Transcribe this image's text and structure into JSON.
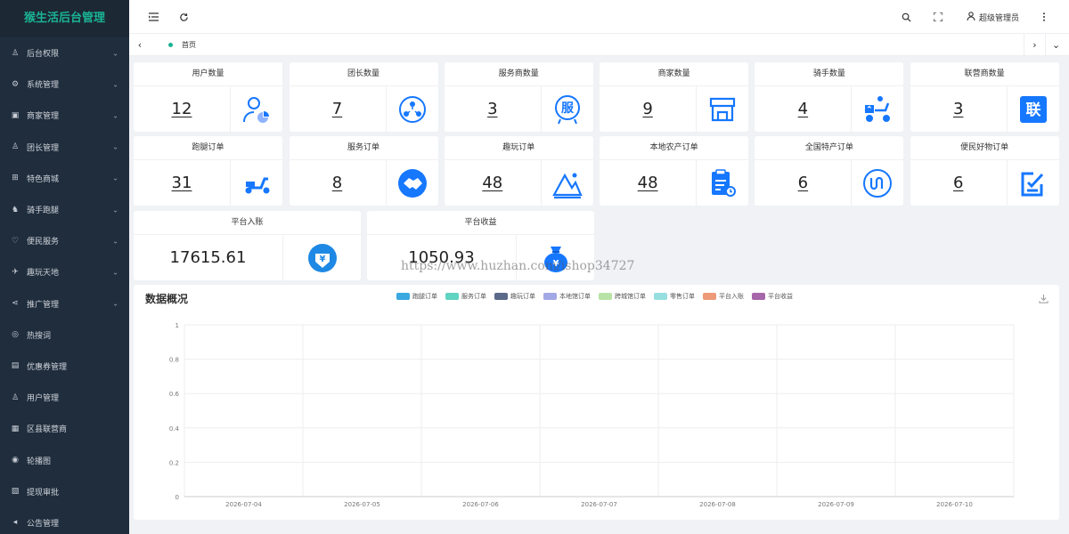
{
  "app": {
    "title": "猴生活后台管理"
  },
  "sidebar": {
    "items": [
      {
        "label": "后台权限",
        "icon": "user-icon",
        "glyph": "♙",
        "arrow": true
      },
      {
        "label": "系统管理",
        "icon": "gear-icon",
        "glyph": "⚙",
        "arrow": true
      },
      {
        "label": "商家管理",
        "icon": "store-icon",
        "glyph": "▣",
        "arrow": true
      },
      {
        "label": "团长管理",
        "icon": "person-icon",
        "glyph": "♙",
        "arrow": true
      },
      {
        "label": "特色商城",
        "icon": "cart-icon",
        "glyph": "⊞",
        "arrow": true
      },
      {
        "label": "骑手跑腿",
        "icon": "rider-icon",
        "glyph": "♞",
        "arrow": true
      },
      {
        "label": "便民服务",
        "icon": "heart-icon",
        "glyph": "♡",
        "arrow": true
      },
      {
        "label": "趣玩天地",
        "icon": "pin-icon",
        "glyph": "✈",
        "arrow": true
      },
      {
        "label": "推广管理",
        "icon": "share-icon",
        "glyph": "⋖",
        "arrow": true
      },
      {
        "label": "热搜词",
        "icon": "fire-icon",
        "glyph": "◎",
        "arrow": false
      },
      {
        "label": "优惠券管理",
        "icon": "coupon-icon",
        "glyph": "▤",
        "arrow": false
      },
      {
        "label": "用户管理",
        "icon": "users-icon",
        "glyph": "♙",
        "arrow": false
      },
      {
        "label": "区县联营商",
        "icon": "region-icon",
        "glyph": "▦",
        "arrow": false
      },
      {
        "label": "轮播图",
        "icon": "carousel-icon",
        "glyph": "◉",
        "arrow": false
      },
      {
        "label": "提现审批",
        "icon": "withdraw-icon",
        "glyph": "▧",
        "arrow": false
      },
      {
        "label": "公告管理",
        "icon": "notice-icon",
        "glyph": "◂",
        "arrow": false
      }
    ]
  },
  "header": {
    "user": "超级管理员"
  },
  "tabs": {
    "home": "首页"
  },
  "colors": {
    "accent": "#1ab394",
    "icon_blue": "#1677ff",
    "sidebar_bg": "#1f2d3d"
  },
  "cards": [
    {
      "title": "用户数量",
      "value": "12",
      "icon": "user-chart-icon"
    },
    {
      "title": "团长数量",
      "value": "7",
      "icon": "team-network-icon"
    },
    {
      "title": "服务商数量",
      "value": "3",
      "icon": "service-badge-icon",
      "glyph": "服"
    },
    {
      "title": "商家数量",
      "value": "9",
      "icon": "shop-icon"
    },
    {
      "title": "骑手数量",
      "value": "4",
      "icon": "scooter-rider-icon"
    },
    {
      "title": "联营商数量",
      "value": "3",
      "icon": "union-badge-icon",
      "glyph": "联"
    },
    {
      "title": "跑腿订单",
      "value": "31",
      "icon": "scooter-icon"
    },
    {
      "title": "服务订单",
      "value": "8",
      "icon": "handshake-icon"
    },
    {
      "title": "趣玩订单",
      "value": "48",
      "icon": "mountain-icon"
    },
    {
      "title": "本地农产订单",
      "value": "48",
      "icon": "clipboard-icon"
    },
    {
      "title": "全国特产订单",
      "value": "6",
      "icon": "route-icon"
    },
    {
      "title": "便民好物订单",
      "value": "6",
      "icon": "edit-check-icon"
    },
    {
      "title": "平台入账",
      "value": "17615.61",
      "icon": "yuan-down-icon",
      "glyph": "¥"
    },
    {
      "title": "平台收益",
      "value": "1050.93",
      "icon": "money-bag-icon",
      "glyph": "¥"
    }
  ],
  "watermark": "https://www.huzhan.com/ishop34727",
  "chart_data": {
    "type": "line",
    "title": "数据概况",
    "x": [
      "2026-07-04",
      "2026-07-05",
      "2026-07-06",
      "2026-07-07",
      "2026-07-08",
      "2026-07-09",
      "2026-07-10"
    ],
    "yticks": [
      "0",
      "0.2",
      "0.4",
      "0.6",
      "0.8",
      "1"
    ],
    "ylim": [
      0,
      1
    ],
    "grid": true,
    "legend_position": "top",
    "series": [
      {
        "name": "跑腿订单",
        "color": "#3ba8e0",
        "values": []
      },
      {
        "name": "服务订单",
        "color": "#5fd4c0",
        "values": []
      },
      {
        "name": "趣玩订单",
        "color": "#5b6a8a",
        "values": []
      },
      {
        "name": "本地馆订单",
        "color": "#a3a8e6",
        "values": []
      },
      {
        "name": "跨城馆订单",
        "color": "#b8e3a6",
        "values": []
      },
      {
        "name": "零售订单",
        "color": "#97dedf",
        "values": []
      },
      {
        "name": "平台入账",
        "color": "#ee9a78",
        "values": []
      },
      {
        "name": "平台收益",
        "color": "#a567a9",
        "values": []
      }
    ]
  }
}
